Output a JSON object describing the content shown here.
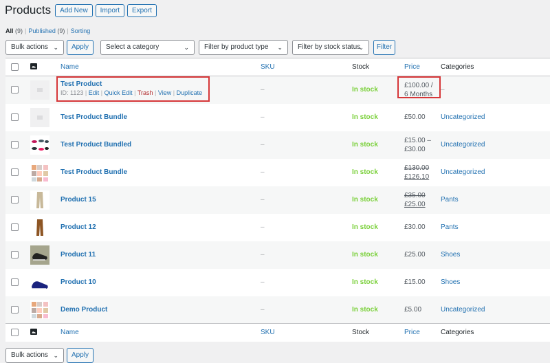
{
  "header": {
    "title": "Products",
    "add_new": "Add New",
    "import": "Import",
    "export": "Export"
  },
  "filters_nav": {
    "all_label": "All",
    "all_count": "(9)",
    "published_label": "Published",
    "published_count": "(9)",
    "sorting_label": "Sorting",
    "sep": "|"
  },
  "toolbar": {
    "bulk_actions": "Bulk actions",
    "apply": "Apply",
    "category": "Select a category",
    "product_type": "Filter by product type",
    "stock_status": "Filter by stock status",
    "filter": "Filter"
  },
  "columns": {
    "name": "Name",
    "sku": "SKU",
    "stock": "Stock",
    "price": "Price",
    "categories": "Categories"
  },
  "row_actions": {
    "id": "ID: 1123",
    "edit": "Edit",
    "quick_edit": "Quick Edit",
    "trash": "Trash",
    "view": "View",
    "duplicate": "Duplicate",
    "sep": "|"
  },
  "rows": [
    {
      "name": "Test Product",
      "sku": "–",
      "stock": "In stock",
      "price_line1": "£100.00 /",
      "price_line2": "6 Months",
      "category": "–",
      "thumb": "placeholder-image"
    },
    {
      "name": "Test Product Bundle",
      "sku": "–",
      "stock": "In stock",
      "price_line1": "£50.00",
      "price_line2": "",
      "category": "Uncategorized",
      "thumb": "placeholder-image"
    },
    {
      "name": "Test Product Bundled",
      "sku": "–",
      "stock": "In stock",
      "price_line1": "£15.00 –",
      "price_line2": "£30.00",
      "category": "Uncategorized",
      "thumb": "shoes-collage"
    },
    {
      "name": "Test Product Bundle",
      "sku": "–",
      "stock": "In stock",
      "price_old": "£130.00",
      "price_new": "£126.10",
      "category": "Uncategorized",
      "thumb": "clothing-collage"
    },
    {
      "name": "Product 15",
      "sku": "–",
      "stock": "In stock",
      "price_old": "£35.00",
      "price_new": "£25.00",
      "category": "Pants",
      "thumb": "beige-pants"
    },
    {
      "name": "Product 12",
      "sku": "–",
      "stock": "In stock",
      "price_line1": "£30.00",
      "price_line2": "",
      "category": "Pants",
      "thumb": "brown-pants"
    },
    {
      "name": "Product 11",
      "sku": "–",
      "stock": "In stock",
      "price_line1": "£25.00",
      "price_line2": "",
      "category": "Shoes",
      "thumb": "black-sneakers"
    },
    {
      "name": "Product 10",
      "sku": "–",
      "stock": "In stock",
      "price_line1": "£15.00",
      "price_line2": "",
      "category": "Shoes",
      "thumb": "navy-sneaker"
    },
    {
      "name": "Demo Product",
      "sku": "–",
      "stock": "In stock",
      "price_line1": "£5.00",
      "price_line2": "",
      "category": "Uncategorized",
      "thumb": "clothing-collage"
    }
  ],
  "colors": {
    "accent": "#2271b1",
    "in_stock": "#7ad03a",
    "trash": "#b32d2e",
    "highlight": "#d63638"
  }
}
